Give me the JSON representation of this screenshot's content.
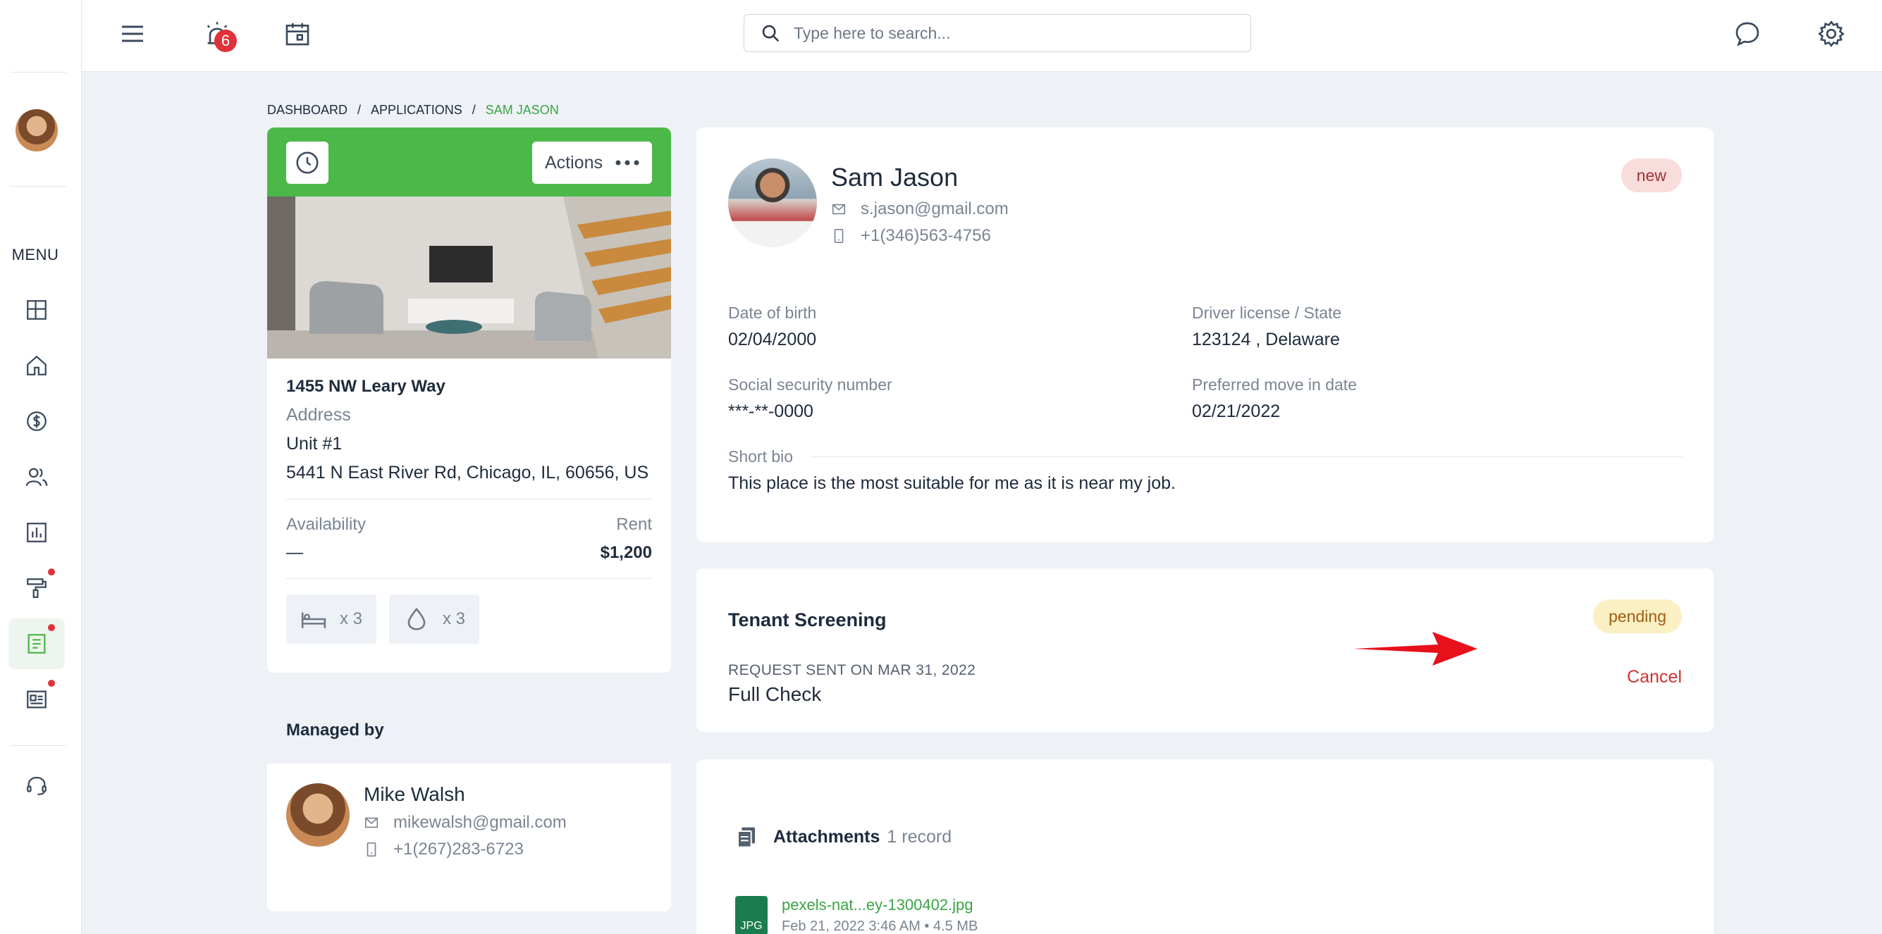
{
  "header": {
    "notification_count": "6",
    "search_placeholder": "Type here to search..."
  },
  "sidebar": {
    "menu_label": "MENU",
    "items": [
      {
        "icon": "dashboard-icon"
      },
      {
        "icon": "home-icon"
      },
      {
        "icon": "dollar-icon"
      },
      {
        "icon": "users-icon"
      },
      {
        "icon": "chart-icon"
      },
      {
        "icon": "paint-roller-icon",
        "dot": true
      },
      {
        "icon": "applications-icon",
        "dot": true,
        "active": true
      },
      {
        "icon": "newspaper-icon",
        "dot": true
      },
      {
        "icon": "headset-icon"
      }
    ]
  },
  "breadcrumb": {
    "items": [
      "DASHBOARD",
      "APPLICATIONS",
      "SAM JASON"
    ],
    "separator": "/"
  },
  "property": {
    "actions_label": "Actions",
    "address_title": "1455 NW Leary Way",
    "address_label": "Address",
    "unit": "Unit #1",
    "full_address": "5441 N East River Rd, Chicago, IL, 60656, US",
    "availability_label": "Availability",
    "availability_value": "—",
    "rent_label": "Rent",
    "rent_value": "$1,200",
    "beds": "x 3",
    "baths": "x 3"
  },
  "manager": {
    "heading": "Managed by",
    "name": "Mike Walsh",
    "email": "mikewalsh@gmail.com",
    "phone": "+1(267)283-6723"
  },
  "applicant": {
    "name": "Sam Jason",
    "email": "s.jason@gmail.com",
    "phone": "+1(346)563-4756",
    "status": "new",
    "dob_label": "Date of birth",
    "dob_value": "02/04/2000",
    "license_label": "Driver license / State",
    "license_value": "123124 , Delaware",
    "ssn_label": "Social security number",
    "ssn_value": "***-**-0000",
    "move_label": "Preferred move in date",
    "move_value": "02/21/2022",
    "bio_label": "Short bio",
    "bio_value": "This place is the most suitable for me as it is near my job."
  },
  "screening": {
    "title": "Tenant Screening",
    "status": "pending",
    "request_sent": "REQUEST SENT ON MAR 31, 2022",
    "check_type": "Full Check",
    "cancel_label": "Cancel"
  },
  "attachments": {
    "title": "Attachments",
    "count": "1 record",
    "file_name": "pexels-nat...ey-1300402.jpg",
    "file_type": "JPG",
    "file_meta": "Feb 21, 2022 3:46 AM • 4.5 MB"
  },
  "colors": {
    "brand_green": "#4cb848",
    "danger": "#d3342e",
    "new_pill_bg": "#f9dcdc",
    "pending_pill_bg": "#fbefc4"
  }
}
